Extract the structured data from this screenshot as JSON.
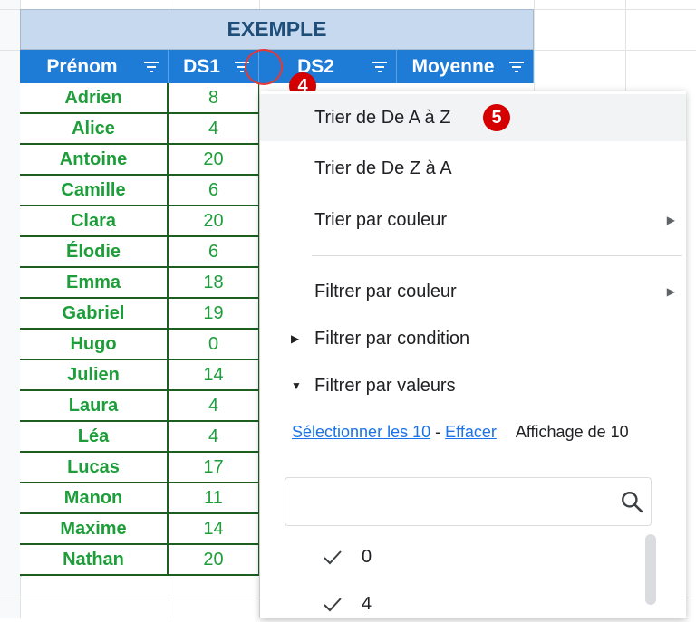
{
  "sheet": {
    "title": "EXEMPLE",
    "headers": [
      "Prénom",
      "DS1",
      "DS2",
      "Moyenne"
    ],
    "rows": [
      {
        "name": "Adrien",
        "ds1": "8"
      },
      {
        "name": "Alice",
        "ds1": "4"
      },
      {
        "name": "Antoine",
        "ds1": "20"
      },
      {
        "name": "Camille",
        "ds1": "6"
      },
      {
        "name": "Clara",
        "ds1": "20"
      },
      {
        "name": "Élodie",
        "ds1": "6"
      },
      {
        "name": "Emma",
        "ds1": "18"
      },
      {
        "name": "Gabriel",
        "ds1": "19"
      },
      {
        "name": "Hugo",
        "ds1": "0"
      },
      {
        "name": "Julien",
        "ds1": "14"
      },
      {
        "name": "Laura",
        "ds1": "4"
      },
      {
        "name": "Léa",
        "ds1": "4"
      },
      {
        "name": "Lucas",
        "ds1": "17"
      },
      {
        "name": "Manon",
        "ds1": "11"
      },
      {
        "name": "Maxime",
        "ds1": "14"
      },
      {
        "name": "Nathan",
        "ds1": "20"
      }
    ]
  },
  "annotations": {
    "step4": "4",
    "step5": "5"
  },
  "menu": {
    "sort_az": "Trier de De A à Z",
    "sort_za": "Trier de De Z à A",
    "sort_color": "Trier par couleur",
    "filter_color": "Filtrer par couleur",
    "filter_condition": "Filtrer par condition",
    "filter_values": "Filtrer par valeurs",
    "select_all": "Sélectionner les 10",
    "link_separator": "-",
    "clear": "Effacer",
    "showing": "Affichage de 10",
    "search_placeholder": "",
    "values": [
      "0",
      "4"
    ]
  },
  "icons": {
    "submenu": "submenu-arrow-icon",
    "collapsed": "caret-right-icon",
    "expanded": "caret-down-icon",
    "search": "search-icon",
    "check": "check-icon",
    "filter": "filter-icon"
  },
  "colors": {
    "header_bg": "#1e7bd6",
    "title_bg": "#c7d9ee",
    "title_text": "#1f4e79",
    "cell_text": "#1e9e3a",
    "annotation": "#d50000",
    "link": "#1a73e8"
  }
}
